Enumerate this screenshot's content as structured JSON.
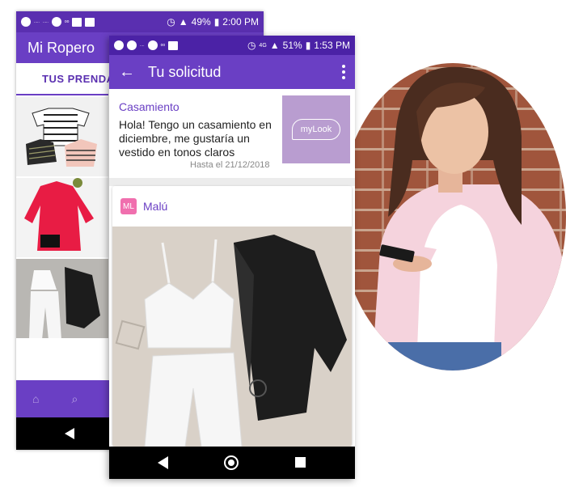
{
  "back_screen": {
    "status_bar": {
      "battery": "49%",
      "time": "2:00 PM"
    },
    "app_title": "Mi Ropero",
    "tab_label": "TUS PRENDA"
  },
  "front_screen": {
    "status_bar": {
      "network": "4G",
      "battery": "51%",
      "time": "1:53 PM"
    },
    "app_title": "Tu solicitud",
    "request": {
      "title": "Casamiento",
      "message": "Hola! Tengo un casamiento en diciembre, me gustaría un vestido en tonos claros",
      "until": "Hasta el 21/12/2018",
      "logo_text": "myLook"
    },
    "stylist": {
      "avatar_text": "ML",
      "name": "Malú"
    }
  },
  "colors": {
    "primary": "#6a3fc4",
    "primary_dark": "#4b22a6",
    "logo_bg": "#b99dd0",
    "avatar_pink": "#f06fae"
  }
}
